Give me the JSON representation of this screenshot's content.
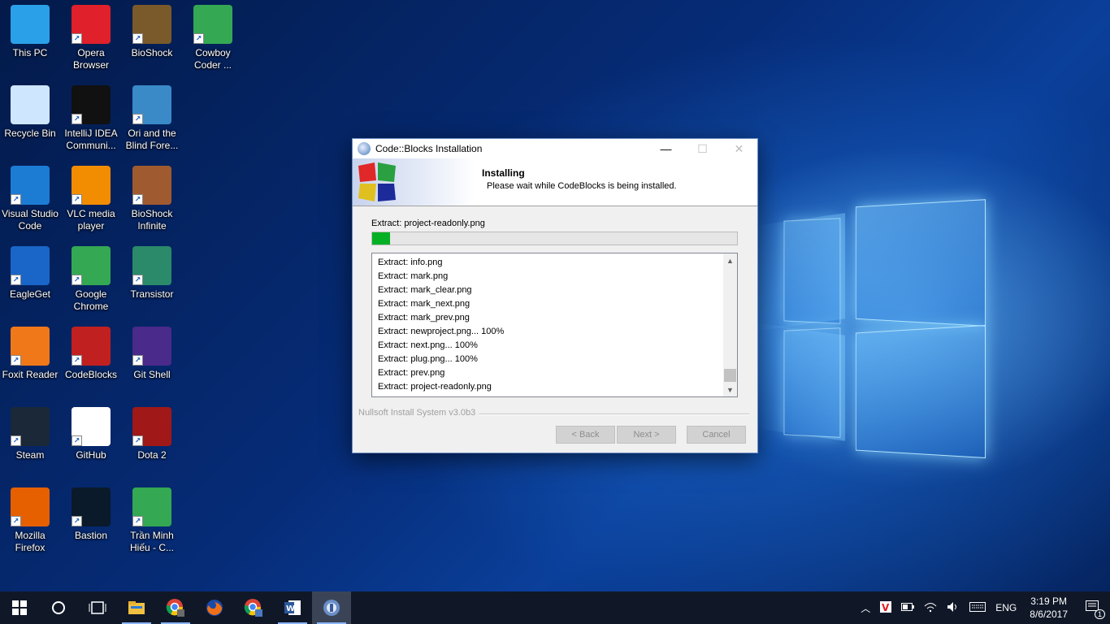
{
  "desktop": {
    "icons": [
      {
        "label": "This PC",
        "icon": "this-pc-icon",
        "color": "#2aa0e8"
      },
      {
        "label": "Opera Browser",
        "icon": "opera-icon",
        "color": "#e0202a"
      },
      {
        "label": "BioShock",
        "icon": "bioshock-icon",
        "color": "#7a5a2a"
      },
      {
        "label": "Cowboy Coder ...",
        "icon": "chrome-profile-icon",
        "color": "#34a853"
      },
      {
        "label": "Recycle Bin",
        "icon": "recycle-bin-icon",
        "color": "#cfe6ff"
      },
      {
        "label": "IntelliJ IDEA Communi...",
        "icon": "intellij-icon",
        "color": "#111111"
      },
      {
        "label": "Ori and the Blind Fore...",
        "icon": "ori-icon",
        "color": "#3a8ac8"
      },
      {
        "label": "Visual Studio Code",
        "icon": "vscode-icon",
        "color": "#1c7cd4"
      },
      {
        "label": "VLC media player",
        "icon": "vlc-icon",
        "color": "#f28c00"
      },
      {
        "label": "BioShock Infinite",
        "icon": "bioshock-infinite-icon",
        "color": "#a05a30"
      },
      {
        "label": "EagleGet",
        "icon": "eagleget-icon",
        "color": "#1a66c8"
      },
      {
        "label": "Google Chrome",
        "icon": "chrome-icon",
        "color": "#34a853"
      },
      {
        "label": "Transistor",
        "icon": "transistor-icon",
        "color": "#2a8a6a"
      },
      {
        "label": "Foxit Reader",
        "icon": "foxit-icon",
        "color": "#f07818"
      },
      {
        "label": "CodeBlocks",
        "icon": "codeblocks-icon",
        "color": "#c02020"
      },
      {
        "label": "Git Shell",
        "icon": "git-shell-icon",
        "color": "#4a2a8a"
      },
      {
        "label": "Steam",
        "icon": "steam-icon",
        "color": "#1b2838"
      },
      {
        "label": "GitHub",
        "icon": "github-icon",
        "color": "#ffffff"
      },
      {
        "label": "Dota 2",
        "icon": "dota2-icon",
        "color": "#a01818"
      },
      {
        "label": "Mozilla Firefox",
        "icon": "firefox-icon",
        "color": "#e66000"
      },
      {
        "label": "Bastion",
        "icon": "bastion-icon",
        "color": "#0a1a2a"
      },
      {
        "label": "Trần Minh Hiếu - C...",
        "icon": "chrome-profile-icon",
        "color": "#34a853"
      }
    ]
  },
  "dialog": {
    "title": "Code::Blocks Installation",
    "minimize": "—",
    "maximize": "☐",
    "close": "✕",
    "header_title": "Installing",
    "header_subtitle": "Please wait while CodeBlocks is being installed.",
    "status": "Extract: project-readonly.png",
    "progress": 0.05,
    "log": [
      "Extract: info.png",
      "Extract: mark.png",
      "Extract: mark_clear.png",
      "Extract: mark_next.png",
      "Extract: mark_prev.png",
      "Extract: newproject.png... 100%",
      "Extract: next.png... 100%",
      "Extract: plug.png... 100%",
      "Extract: prev.png",
      "Extract: project-readonly.png"
    ],
    "branding": "Nullsoft Install System v3.0b3",
    "back_label": "< Back",
    "next_label": "Next >",
    "cancel_label": "Cancel"
  },
  "taskbar": {
    "language": "ENG",
    "time": "3:19 PM",
    "date": "8/6/2017",
    "notification_count": "1"
  }
}
